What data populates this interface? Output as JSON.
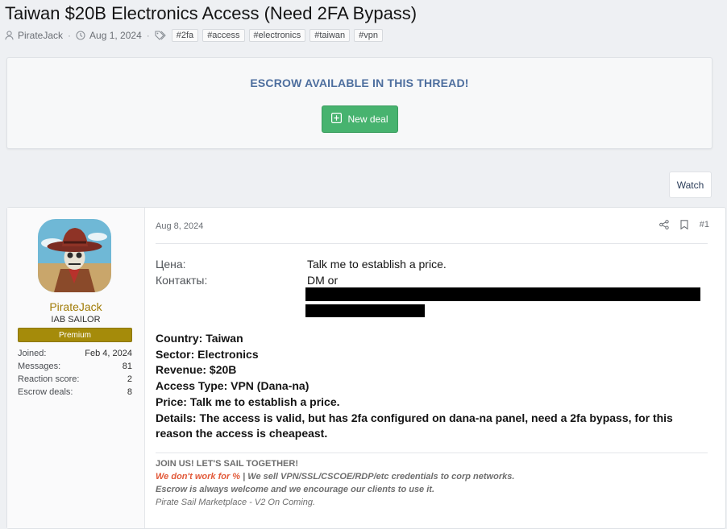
{
  "thread": {
    "title": "Taiwan $20B Electronics Access (Need 2FA Bypass)",
    "author": "PirateJack",
    "date": "Aug 1, 2024",
    "tags": [
      "#2fa",
      "#access",
      "#electronics",
      "#taiwan",
      "#vpn"
    ]
  },
  "escrow": {
    "heading": "ESCROW AVAILABLE IN THIS THREAD!",
    "button_label": "New deal"
  },
  "watch_label": "Watch",
  "post": {
    "date": "Aug 8, 2024",
    "number": "#1",
    "user": {
      "name": "PirateJack",
      "title": "IAB SAILOR",
      "banner": "Premium",
      "stats": [
        {
          "label": "Joined:",
          "value": "Feb 4, 2024"
        },
        {
          "label": "Messages:",
          "value": "81"
        },
        {
          "label": "Reaction score:",
          "value": "2"
        },
        {
          "label": "Escrow deals:",
          "value": "8"
        }
      ]
    },
    "fields": {
      "price_label": "Цена:",
      "price_value": "Talk me to establish a price.",
      "contacts_label": "Контакты:",
      "contacts_value": "DM or"
    },
    "details": [
      "Country: Taiwan",
      "Sector: Electronics",
      "Revenue: $20B",
      "Access Type: VPN (Dana-na)",
      "Price: Talk me to establish a price.",
      "Details: The access is valid, but has 2fa configured on dana-na panel, need a 2fa bypass, for this reason the access is cheapeast."
    ],
    "signature": {
      "line1": "JOIN US! LET'S SAIL TOGETHER!",
      "line2_red": "We don't work for %",
      "line2_rest": " | We sell VPN/SSL/CSCOE/RDP/etc credentials to corp networks.",
      "line3": "Escrow is always welcome and we encourage our clients to use it.",
      "line4": "Pirate Sail Marketplace - V2 On Coming."
    }
  },
  "colors": {
    "accent": "#4d6e9e",
    "button_green": "#47b36f",
    "username_gold": "#a07b06",
    "banner_gold": "#a58b0a",
    "signature_red": "#e25a3a"
  },
  "icons": [
    "user-icon",
    "clock-icon",
    "tags-icon",
    "plus-square-icon",
    "share-icon",
    "bookmark-icon"
  ]
}
